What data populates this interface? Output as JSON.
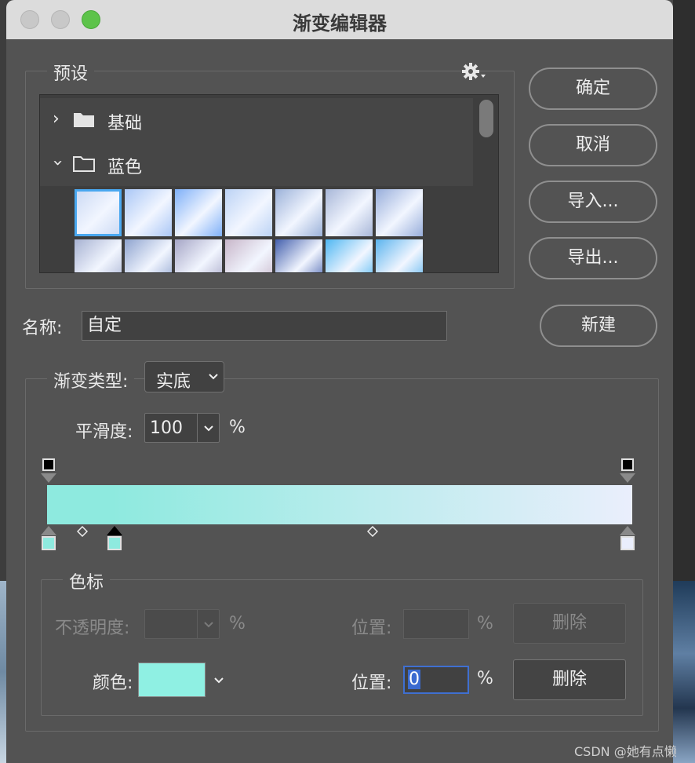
{
  "window": {
    "title": "渐变编辑器"
  },
  "presets": {
    "label": "预设",
    "settings_icon": "gear-icon",
    "folders": [
      {
        "label": "基础",
        "expanded": false
      },
      {
        "label": "蓝色",
        "expanded": true
      }
    ],
    "swatches_row1": [
      "#c9d8f3",
      "#aac7f6",
      "#7fb0f8",
      "#bcd3f5",
      "#9cb2d9",
      "#a8b7d8",
      "#98aedb"
    ],
    "swatches_row2": [
      "#a7b2d2",
      "#8fa4cf",
      "#a6a6c6",
      "#c8b6c9",
      "#4460ad",
      "#4fb7f2",
      "#5bb4ee"
    ]
  },
  "buttons": {
    "ok": "确定",
    "cancel": "取消",
    "import": "导入...",
    "export": "导出...",
    "new": "新建"
  },
  "name": {
    "label": "名称:",
    "value": "自定"
  },
  "gradient": {
    "type_label": "渐变类型:",
    "type_value": "实底",
    "smoothness_label": "平滑度:",
    "smoothness_value": "100",
    "percent": "%",
    "start_color": "#8eeadf",
    "end_color": "#eaeefc"
  },
  "color_stops": {
    "label": "色标",
    "opacity_label": "不透明度:",
    "opacity_value": "",
    "opacity_percent": "%",
    "opacity_position_label": "位置:",
    "opacity_position_value": "",
    "opacity_position_percent": "%",
    "opacity_delete": "删除",
    "color_label": "颜色:",
    "color_value": "#8ff0e3",
    "color_position_label": "位置:",
    "color_position_value": "0",
    "color_position_percent": "%",
    "color_delete": "删除"
  },
  "watermark": "CSDN @她有点懒"
}
